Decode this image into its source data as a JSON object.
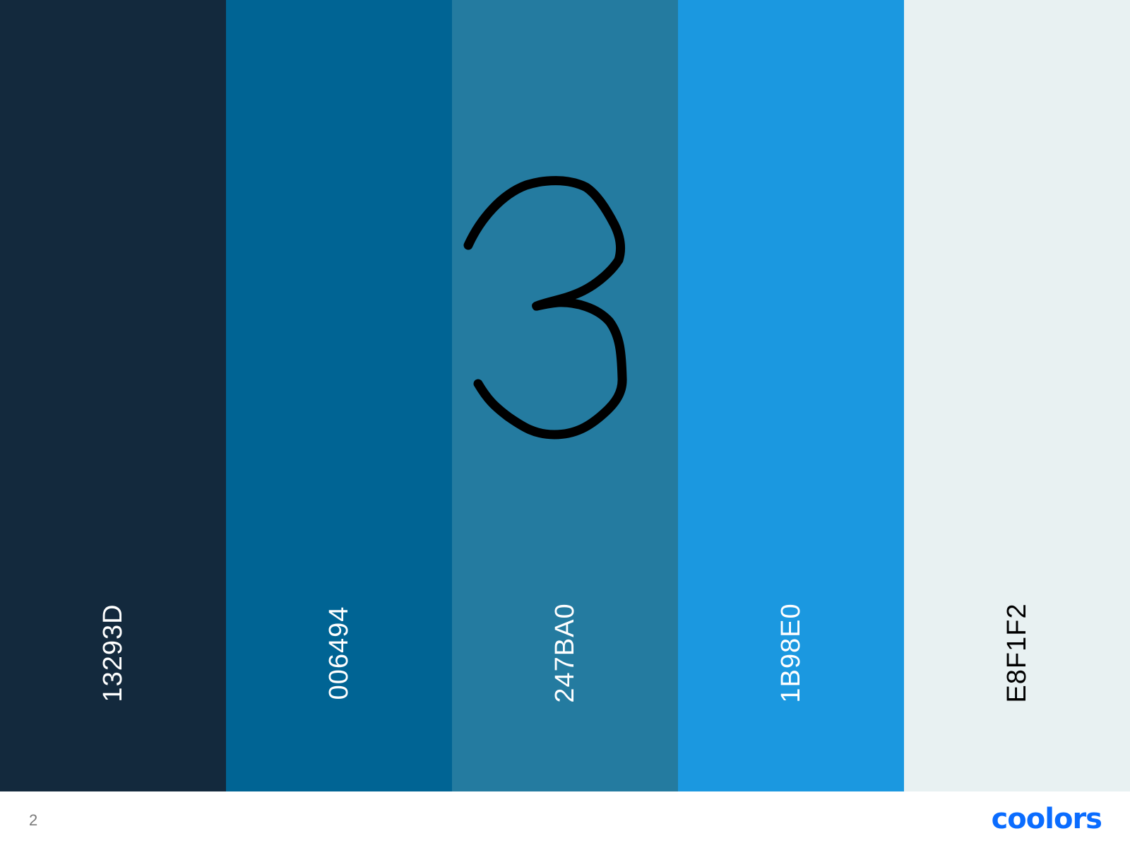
{
  "palette": {
    "swatches": [
      {
        "hex": "13293D",
        "color": "#13293D",
        "text_color": "#FFFFFF"
      },
      {
        "hex": "006494",
        "color": "#006494",
        "text_color": "#FFFFFF"
      },
      {
        "hex": "247BA0",
        "color": "#247BA0",
        "text_color": "#FFFFFF"
      },
      {
        "hex": "1B98E0",
        "color": "#1B98E0",
        "text_color": "#FFFFFF"
      },
      {
        "hex": "E8F1F2",
        "color": "#E8F1F2",
        "text_color": "#000000"
      }
    ]
  },
  "annotation": {
    "text": "3"
  },
  "footer": {
    "page_number": "2",
    "logo_text": "coolors",
    "logo_color": "#0A6CFF"
  }
}
